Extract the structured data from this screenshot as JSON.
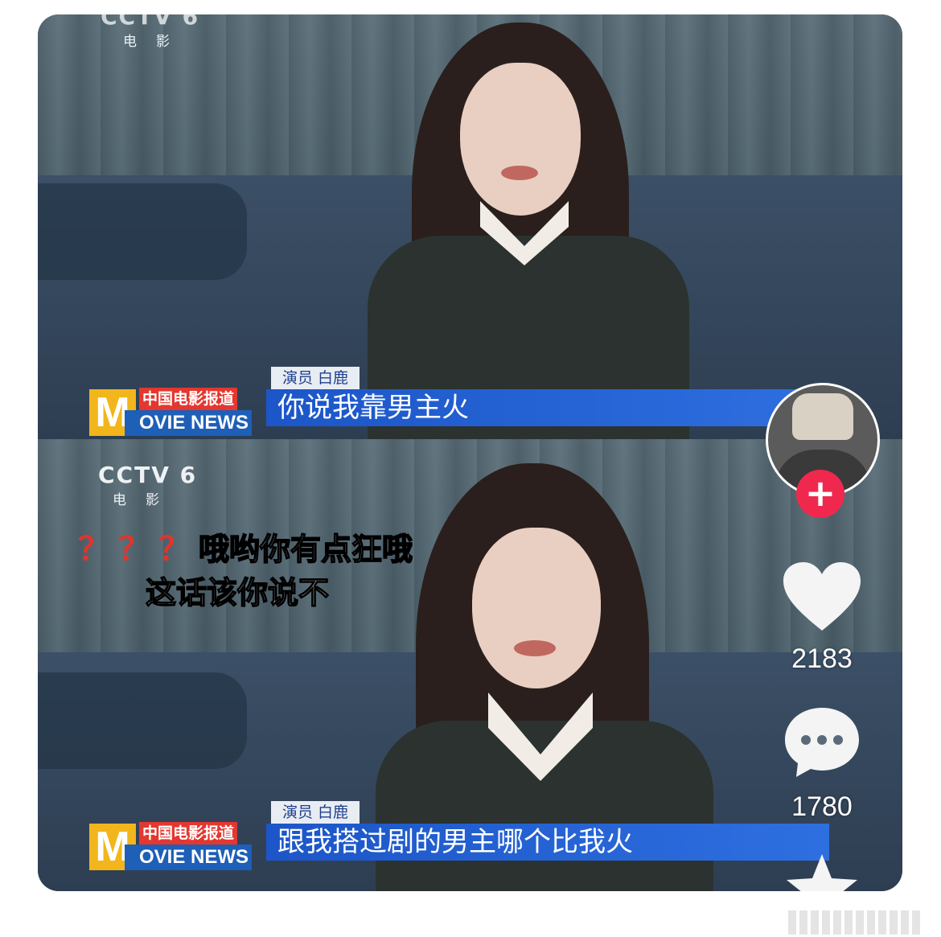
{
  "top_clip": {
    "channel": "",
    "tag": "演员 白鹿",
    "caption": "你说我靠男主火"
  },
  "bottom_clip": {
    "channel_logo": "CCTV 6",
    "channel_sub": "电影",
    "tag": "演员 白鹿",
    "caption": "跟我搭过剧的男主哪个比我火",
    "comment_marks": "？？？",
    "comment_line1": "哦哟你有点狂哦",
    "comment_line2": "这话该你说不"
  },
  "brand": {
    "logo_letter": "M",
    "logo_cn": "中国电影报道",
    "logo_en": "OVIE NEWS"
  },
  "sidebar": {
    "follow_label": "+",
    "likes": "2183",
    "comments": "1780",
    "heart_icon": "heart-icon",
    "comment_icon": "comment-bubble-icon",
    "star_icon": "star-icon"
  },
  "colors": {
    "caption_blue": "#1c56c8",
    "logo_red": "#e4372f",
    "logo_yellow": "#f2b51b",
    "follow_pink": "#f0284e"
  }
}
